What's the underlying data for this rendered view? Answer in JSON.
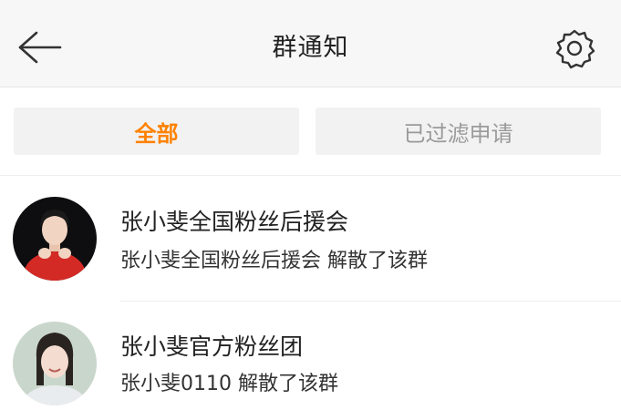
{
  "header": {
    "title": "群通知",
    "back_icon": "arrow-left-icon",
    "settings_icon": "gear-icon"
  },
  "tabs": [
    {
      "label": "全部",
      "active": true
    },
    {
      "label": "已过滤申请",
      "active": false
    }
  ],
  "notifications": [
    {
      "group_name": "张小斐全国粉丝后援会",
      "message": "张小斐全国粉丝后援会 解散了该群"
    },
    {
      "group_name": "张小斐官方粉丝团",
      "message": "张小斐0110 解散了该群"
    }
  ],
  "colors": {
    "accent": "#ff8200",
    "header_bg": "#f7f7f7",
    "tab_bg": "#f2f2f2",
    "inactive_text": "#9a9a9a"
  }
}
